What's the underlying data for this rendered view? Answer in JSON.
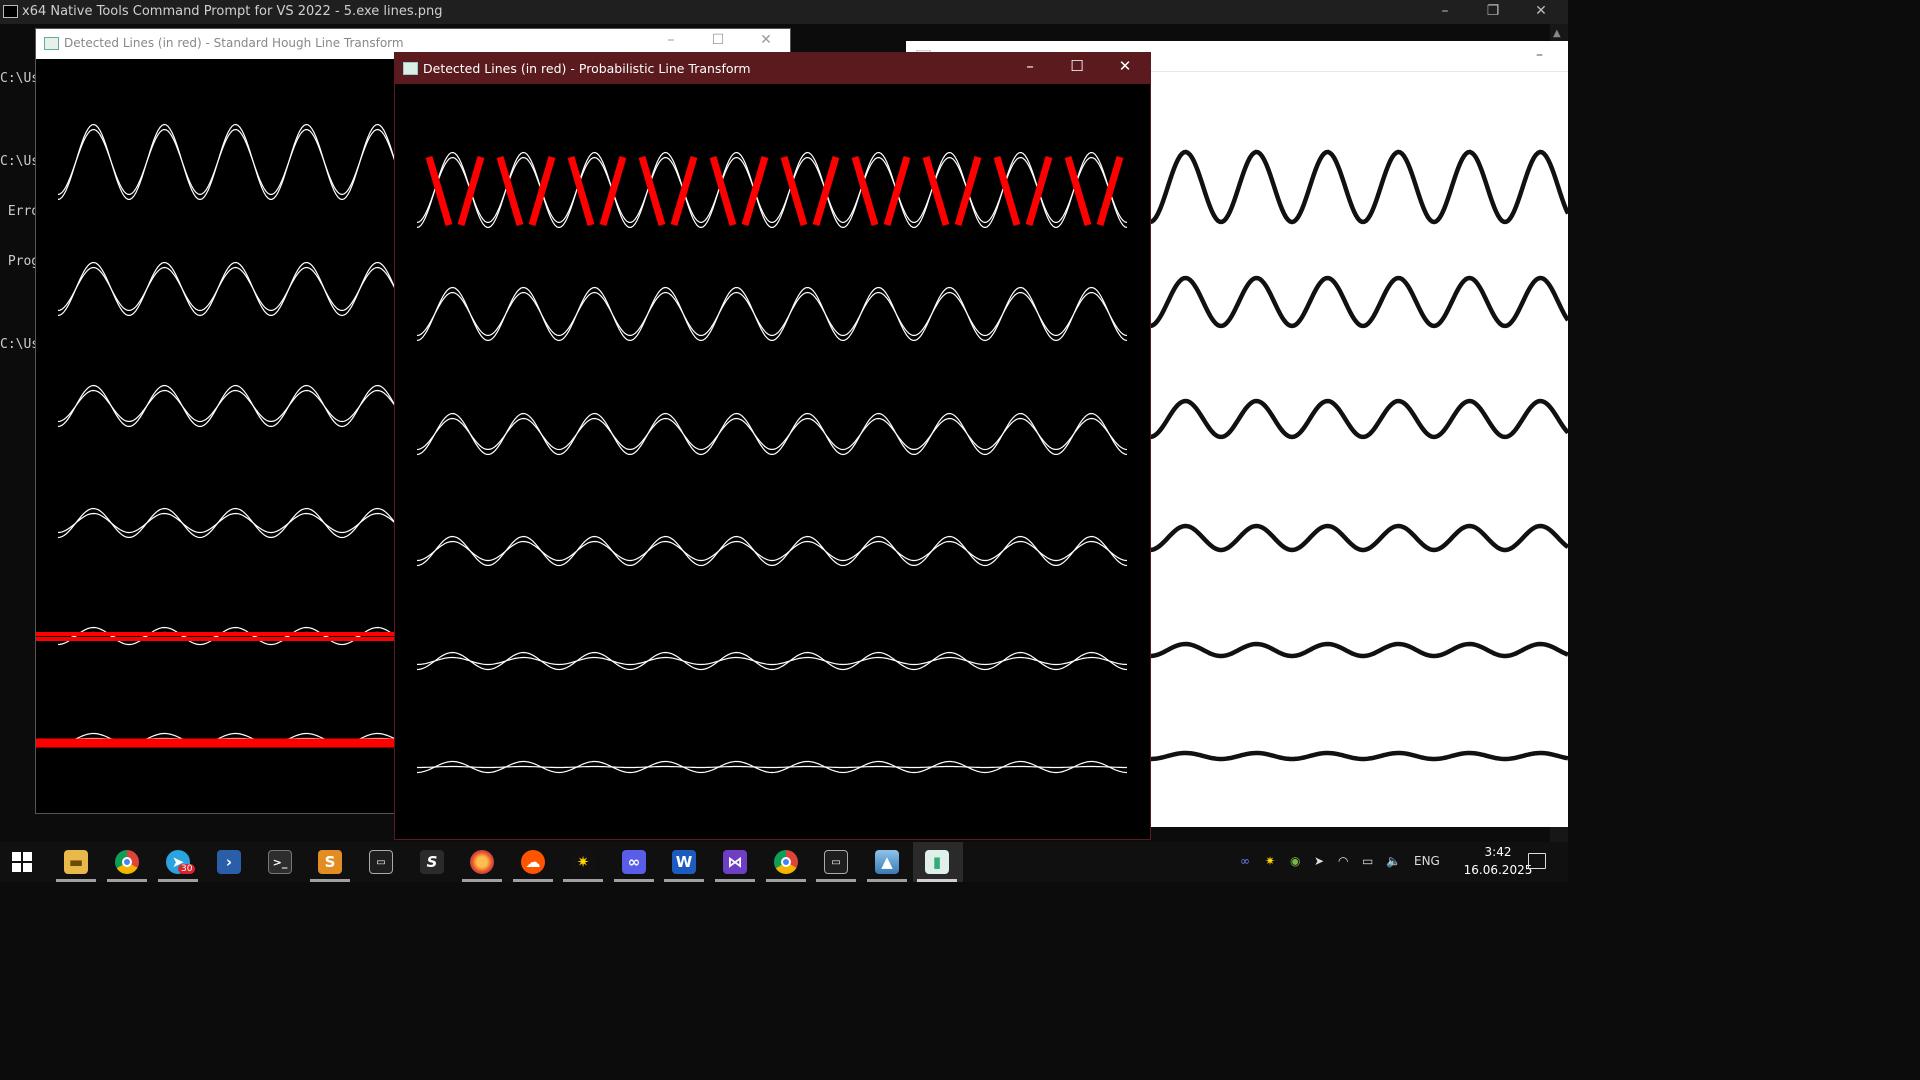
{
  "console": {
    "title": "x64 Native Tools Command Prompt for VS 2022 - 5.exe  lines.png",
    "lines": [
      "C:\\Us",
      "",
      "C:\\Us",
      " Erro",
      " Prog",
      "",
      "C:\\Us"
    ]
  },
  "standard_window": {
    "title": "Detected Lines (in red) - Standard Hough Line Transform"
  },
  "probabilistic_window": {
    "title": "Detected Lines (in red) - Probabilistic Line Transform"
  },
  "source_window": {
    "title": ""
  },
  "colors": {
    "detected_line": "#ff0000",
    "edge": "#ffffff",
    "prob_titlebar": "#5a1a1e",
    "taskbar": "#101010"
  },
  "taskbar": {
    "apps": [
      {
        "name": "start-icon"
      },
      {
        "name": "file-explorer-icon"
      },
      {
        "name": "chrome-icon"
      },
      {
        "name": "telegram-icon",
        "badge": "30"
      },
      {
        "name": "powershell-icon"
      },
      {
        "name": "terminal-icon"
      },
      {
        "name": "sublime-text-icon"
      },
      {
        "name": "command-prompt-icon"
      },
      {
        "name": "s-app-icon"
      },
      {
        "name": "firefox-icon"
      },
      {
        "name": "soundcloud-icon"
      },
      {
        "name": "sun-app-icon"
      },
      {
        "name": "link-app-icon"
      },
      {
        "name": "word-icon"
      },
      {
        "name": "visual-studio-icon"
      },
      {
        "name": "chrome-canary-icon"
      },
      {
        "name": "console-icon"
      },
      {
        "name": "photos-icon"
      },
      {
        "name": "opencv-window-icon"
      }
    ],
    "tray": {
      "language": "ENG",
      "time": "3:42",
      "date": "16.06.2025"
    }
  }
}
